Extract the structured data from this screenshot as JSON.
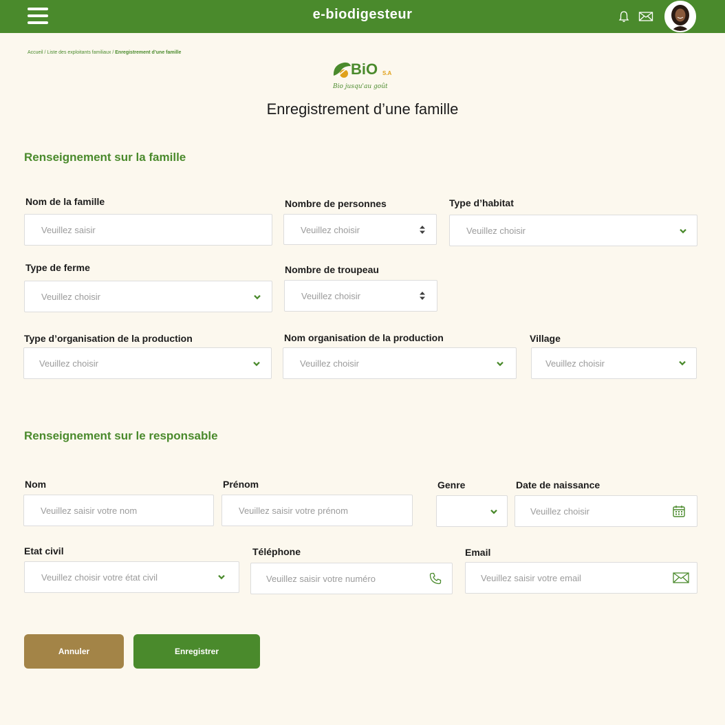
{
  "app": {
    "title": "e-biodigesteur"
  },
  "header": {
    "menu_icon": "hamburger-icon",
    "bell_icon": "bell-icon",
    "mail_icon": "mail-icon",
    "avatar": "user-avatar"
  },
  "breadcrumb": {
    "items": [
      "Accueil",
      "Liste des exploitants familiaux",
      "Enregistrement d’une famille"
    ],
    "separator": " / "
  },
  "logo": {
    "brand": "BiO",
    "suffix": "S.A",
    "tagline": "Bio jusqu'au goût"
  },
  "page": {
    "title": "Enregistrement d’une famille"
  },
  "family_section": {
    "title": "Renseignement sur la famille",
    "nom_famille": {
      "label": "Nom de la famille",
      "placeholder": "Veuillez saisir"
    },
    "nombre_personnes": {
      "label": "Nombre de personnes",
      "placeholder": "Veuillez choisir"
    },
    "type_habitat": {
      "label": "Type d’habitat",
      "placeholder": "Veuillez choisir"
    },
    "type_ferme": {
      "label": "Type de ferme",
      "placeholder": "Veuillez choisir"
    },
    "nombre_troupeau": {
      "label": "Nombre de troupeau",
      "placeholder": "Veuillez choisir"
    },
    "type_organisation": {
      "label": "Type d’organisation de la production",
      "placeholder": "Veuillez choisir"
    },
    "nom_organisation": {
      "label": "Nom organisation de la production",
      "placeholder": "Veuillez choisir"
    },
    "village": {
      "label": "Village",
      "placeholder": "Veuillez choisir"
    }
  },
  "responsable_section": {
    "title": "Renseignement sur le responsable",
    "nom": {
      "label": "Nom",
      "placeholder": "Veuillez saisir votre nom"
    },
    "prenom": {
      "label": "Prénom",
      "placeholder": "Veuillez saisir votre prénom"
    },
    "genre": {
      "label": "Genre",
      "placeholder": ""
    },
    "date_naissance": {
      "label": "Date de naissance",
      "placeholder": "Veuillez choisir"
    },
    "etat_civil": {
      "label": "Etat civil",
      "placeholder": "Veuillez choisir votre état civil"
    },
    "telephone": {
      "label": "Téléphone",
      "placeholder": "Veuillez saisir votre numéro"
    },
    "email": {
      "label": "Email",
      "placeholder": "Veuillez saisir votre email"
    }
  },
  "actions": {
    "cancel": "Annuler",
    "submit": "Enregistrer"
  },
  "colors": {
    "primary": "#4a8a2c",
    "background": "#fcf8ee",
    "cancel": "#a38447",
    "logo_accent": "#e0a11b"
  }
}
